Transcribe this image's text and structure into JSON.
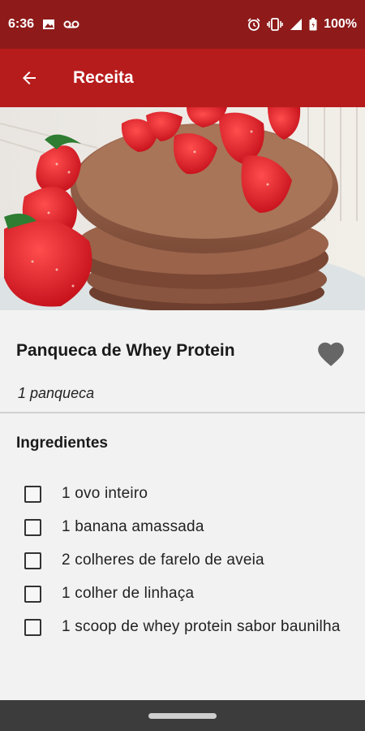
{
  "status_bar": {
    "time": "6:36",
    "battery": "100%",
    "left_icons": [
      "image-icon",
      "voicemail-icon"
    ],
    "right_icons": [
      "alarm-icon",
      "vibrate-icon",
      "signal-icon",
      "battery-icon"
    ]
  },
  "app_bar": {
    "title": "Receita",
    "back_icon": "arrow-left-icon",
    "color": "#b71c1c"
  },
  "recipe": {
    "title": "Panqueca de Whey Protein",
    "yield": "1 panqueca",
    "favorite_icon": "heart-icon",
    "image": "photo of stacked chocolate pancakes with strawberries"
  },
  "ingredients": {
    "heading": "Ingredientes",
    "items": [
      {
        "label": "1 ovo inteiro",
        "checked": false
      },
      {
        "label": "1 banana amassada",
        "checked": false
      },
      {
        "label": "2 colheres de farelo de aveia",
        "checked": false
      },
      {
        "label": "1 colher de linhaça",
        "checked": false
      },
      {
        "label": "1 scoop de whey protein sabor baunilha",
        "checked": false
      }
    ]
  }
}
